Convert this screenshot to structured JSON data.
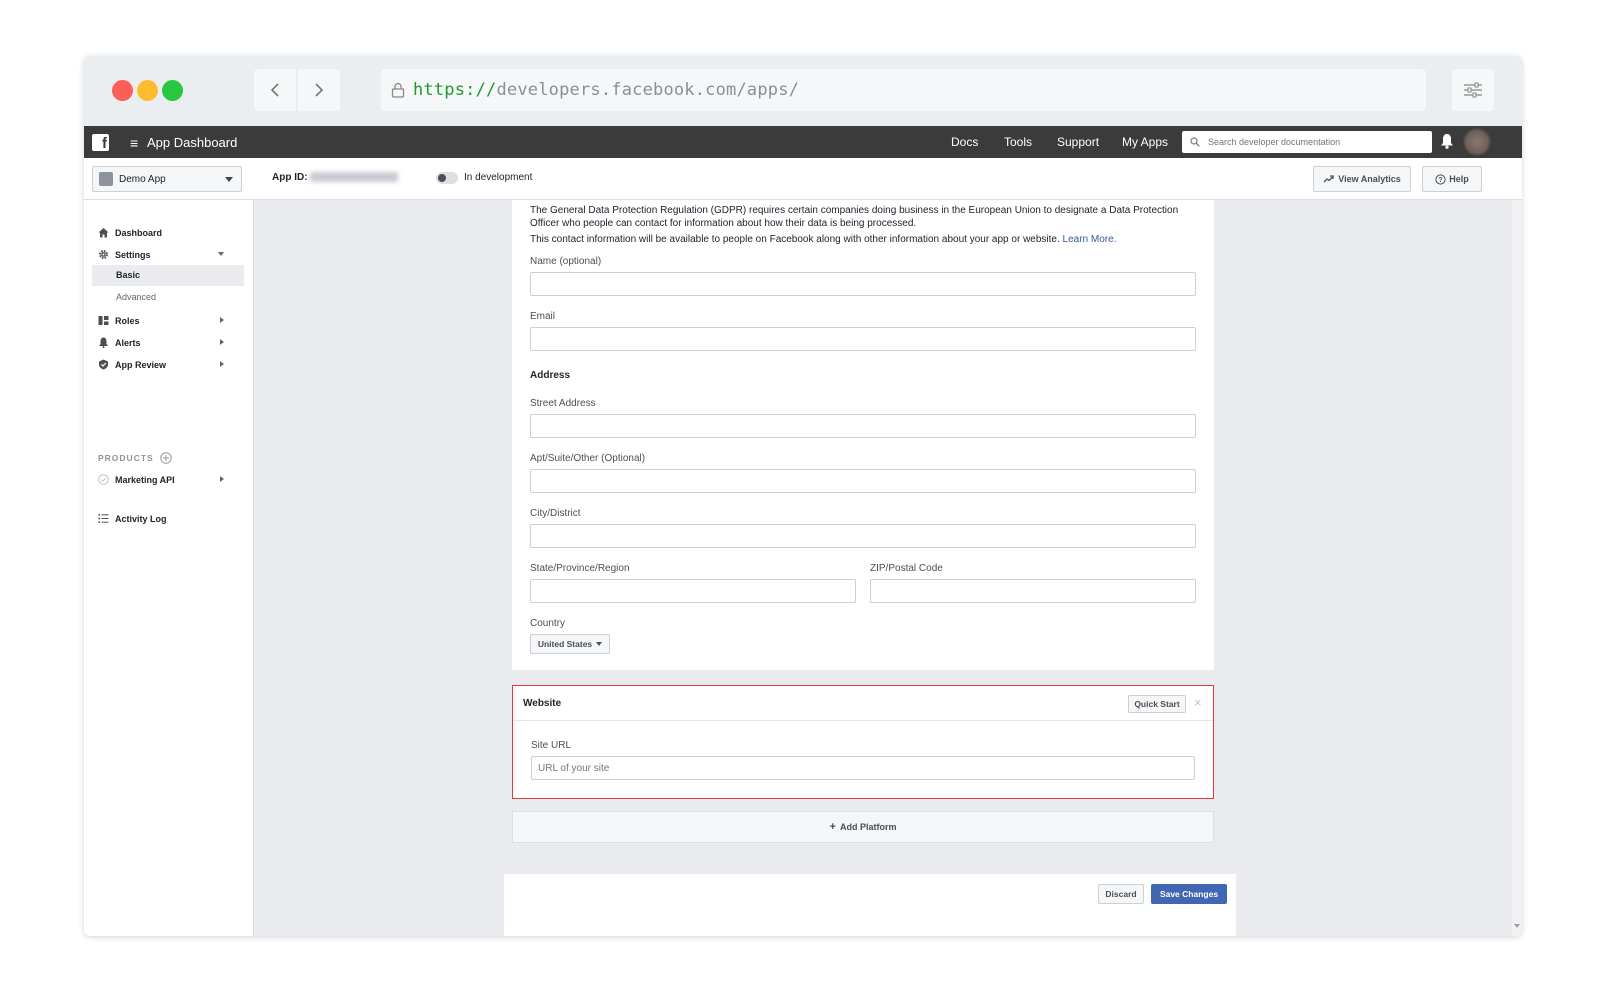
{
  "browser": {
    "url_scheme": "https://",
    "url_rest": "developers.facebook.com/apps/"
  },
  "topbar": {
    "title": "App Dashboard",
    "nav": [
      "Docs",
      "Tools",
      "Support",
      "My Apps"
    ],
    "search_placeholder": "Search developer documentation"
  },
  "subheader": {
    "app_name": "Demo App",
    "app_id_label": "App ID:",
    "status": "In development",
    "analytics_label": "View Analytics",
    "help_label": "Help"
  },
  "sidebar": {
    "dashboard": "Dashboard",
    "settings": "Settings",
    "basic": "Basic",
    "advanced": "Advanced",
    "roles": "Roles",
    "alerts": "Alerts",
    "app_review": "App Review",
    "products_heading": "PRODUCTS",
    "marketing_api": "Marketing API",
    "activity_log": "Activity Log"
  },
  "form": {
    "gdpr_text": "The General Data Protection Regulation (GDPR) requires certain companies doing business in the European Union to designate a Data Protection Officer who people can contact for information about how their data is being processed.",
    "contact_text": "This contact information will be available to people on Facebook along with other information about your app or website.",
    "learn_more": "Learn More.",
    "name_label": "Name (optional)",
    "email_label": "Email",
    "address_heading": "Address",
    "street_label": "Street Address",
    "apt_label": "Apt/Suite/Other (Optional)",
    "city_label": "City/District",
    "state_label": "State/Province/Region",
    "zip_label": "ZIP/Postal Code",
    "country_label": "Country",
    "country_value": "United States"
  },
  "website": {
    "title": "Website",
    "quick_start": "Quick Start",
    "close": "×",
    "site_url_label": "Site URL",
    "site_url_placeholder": "URL of your site"
  },
  "add_platform": "Add Platform",
  "footer": {
    "discard": "Discard",
    "save": "Save Changes"
  },
  "colors": {
    "accent": "#4267b2",
    "highlight": "#e0383e",
    "topbar": "#3b3b3b"
  }
}
